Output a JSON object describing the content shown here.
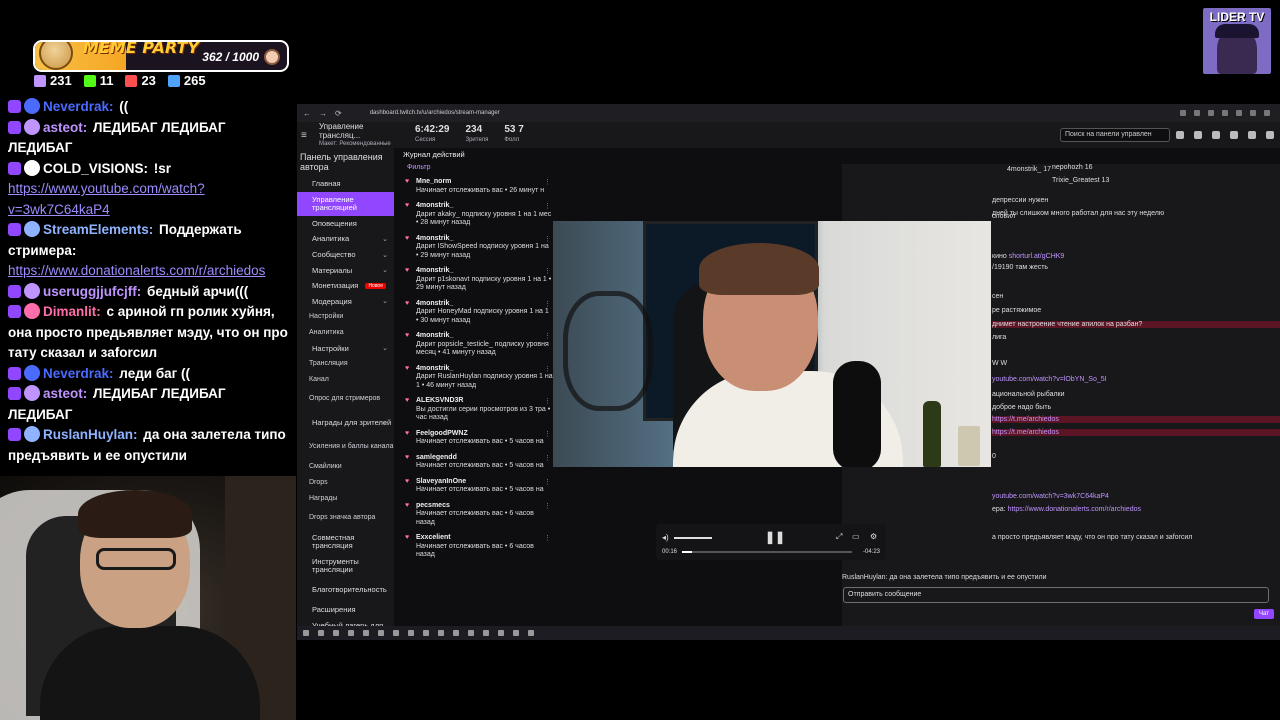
{
  "meme_party": {
    "title": "MEME PARTY",
    "count": "362 / 1000",
    "progress": 0.362
  },
  "stats": [
    {
      "icon": "twitch-icon",
      "value": "231",
      "color": "#bf94ff"
    },
    {
      "icon": "kick-icon",
      "value": "11",
      "color": "#53fc18"
    },
    {
      "icon": "live-icon",
      "value": "23",
      "color": "#ff4f4f"
    },
    {
      "icon": "viewers-icon",
      "value": "265",
      "color": "#4fa3ff"
    }
  ],
  "chat": [
    {
      "nick": "Neverdrak:",
      "nick_color": "#4b6bff",
      "text": " ((",
      "link": ""
    },
    {
      "nick": "asteot:",
      "nick_color": "#bf94ff",
      "text": " ЛЕДИБАГ ЛЕДИБАГ ЛЕДИБАГ",
      "link": ""
    },
    {
      "nick": "COLD_VISIONS:",
      "nick_color": "#ffffff",
      "text": " !sr",
      "link": "https://www.youtube.com/watch?v=3wk7C64kaP4"
    },
    {
      "nick": "StreamElements:",
      "nick_color": "#8fb3ff",
      "text": " Поддержать стримера:",
      "link": "https://www.donationalerts.com/r/archiedos"
    },
    {
      "nick": "useruggjjufcjff:",
      "nick_color": "#bf94ff",
      "text": " бедный арчи(((",
      "link": ""
    },
    {
      "nick": "Dimanlit:",
      "nick_color": "#ff6dab",
      "text": " с ариной гп ролик хуйня, она просто предьявляет мэду, что он про тату сказал и заforсил",
      "link": ""
    },
    {
      "nick": "Neverdrak:",
      "nick_color": "#4b6bff",
      "text": " леди баг ((",
      "link": ""
    },
    {
      "nick": "asteot:",
      "nick_color": "#bf94ff",
      "text": " ЛЕДИБАГ ЛЕДИБАГ ЛЕДИБАГ",
      "link": ""
    },
    {
      "nick": "RuslanHuylan:",
      "nick_color": "#8fb3ff",
      "text": " да она залетела типо предъявить и ее опустили",
      "link": ""
    }
  ],
  "browser": {
    "url": "dashboard.twitch.tv/u/archiedos/stream-manager"
  },
  "header": {
    "title": "Управление трансляц...",
    "subtitle": "Макет: Рекомендованные",
    "session": "6:42:29",
    "session_label": "Сессия",
    "viewers": "234",
    "viewers_label": "Зрителя",
    "followers": "53 7",
    "followers_label": "Фолл",
    "search_placeholder": "Поиск на панели управлен"
  },
  "sidebar": {
    "title": "Панель управления автора",
    "items": [
      {
        "label": "Главная",
        "type": "main",
        "chev": false
      },
      {
        "label": "Управление трансляцией",
        "type": "active",
        "chev": false
      },
      {
        "label": "Оповещения",
        "type": "main",
        "chev": false
      },
      {
        "label": "Аналитика",
        "type": "main",
        "chev": true
      },
      {
        "label": "Сообщество",
        "type": "main",
        "chev": true
      },
      {
        "label": "Материалы",
        "type": "main",
        "chev": true
      },
      {
        "label": "Монетизация",
        "type": "main",
        "chev": true,
        "badge": "Новое"
      },
      {
        "label": "Модерация",
        "type": "main",
        "chev": true
      },
      {
        "label": "Настройки",
        "type": "sub",
        "chev": false
      },
      {
        "label": "Аналитика",
        "type": "sub",
        "chev": false
      },
      {
        "label": "Настройки",
        "type": "main",
        "chev": true
      },
      {
        "label": "Трансляция",
        "type": "sub",
        "chev": false
      },
      {
        "label": "Канал",
        "type": "sub",
        "chev": false
      },
      {
        "label": "Опрос для стримеров",
        "type": "sub",
        "chev": false
      },
      {
        "label": "Награды для зрителей",
        "type": "main",
        "chev": true
      },
      {
        "label": "Усиления и баллы канала",
        "type": "sub",
        "chev": false
      },
      {
        "label": "Смайлики",
        "type": "sub",
        "chev": false
      },
      {
        "label": "Drops",
        "type": "sub",
        "chev": false
      },
      {
        "label": "Награды",
        "type": "sub",
        "chev": false
      },
      {
        "label": "Drops значка автора",
        "type": "sub",
        "chev": false
      },
      {
        "label": "Совместная трансляция",
        "type": "main",
        "chev": false
      },
      {
        "label": "Инструменты трансляции",
        "type": "main",
        "chev": false
      },
      {
        "label": "Благотворительность",
        "type": "main",
        "chev": false
      },
      {
        "label": "Расширения",
        "type": "main",
        "chev": false
      },
      {
        "label": "Учебный лагерь для стримеров",
        "type": "main",
        "chev": false
      }
    ]
  },
  "feed": {
    "title": "Журнал действий",
    "filter": "Фильтр",
    "items": [
      {
        "name": "Mne_norm",
        "text": "Начинает отслеживать вас • 26 минут н"
      },
      {
        "name": "4monstrik_",
        "text": "Дарит akaky_ подписку уровня 1 на 1 мес • 28 минут назад"
      },
      {
        "name": "4monstrik_",
        "text": "Дарит IShowSpeed подписку уровня 1 на • 29 минут назад"
      },
      {
        "name": "4monstrik_",
        "text": "Дарит p1skonavt подписку уровня 1 на 1 • 29 минут назад"
      },
      {
        "name": "4monstrik_",
        "text": "Дарит HoneyMad подписку уровня 1 на 1 • 30 минут назад"
      },
      {
        "name": "4monstrik_",
        "text": "Дарит popsicle_testicle_ подписку уровня месяц • 41 минуту назад"
      },
      {
        "name": "4monstrik_",
        "text": "Дарит RuslanHuylan подписку уровня 1 на 1 • 46 минут назад"
      },
      {
        "name": "ALEKSVND3R",
        "text": "Вы достигли серии просмотров из 3 тра • час назад"
      },
      {
        "name": "FeelgoodPWNZ",
        "text": "Начинает отслеживать вас • 5 часов на"
      },
      {
        "name": "samlegendd",
        "text": "Начинает отслеживать вас • 5 часов на"
      },
      {
        "name": "SlaveyanInOne",
        "text": "Начинает отслеживать вас • 5 часов на"
      },
      {
        "name": "pecsmecs",
        "text": "Начинает отслеживать вас • 6 часов назад"
      },
      {
        "name": "Exxcelient",
        "text": "Начинает отслеживать вас • 6 часов назад"
      }
    ]
  },
  "right_chat": {
    "top_users": [
      {
        "name": "4monstrik_",
        "count": "17"
      },
      {
        "name": "nepohozh",
        "count": "16"
      },
      {
        "name": "Trixie_Greatest",
        "count": "13"
      }
    ],
    "lines": [
      {
        "text": "депрессии нужен",
        "hl": false,
        "link": ""
      },
      {
        "text": "дней ты слишком много работал для нас эту неделю",
        "hl": false,
        "link": ""
      },
      {
        "text": "словил",
        "hl": false,
        "link": ""
      },
      {
        "text": "кино",
        "hl": false,
        "link": "shorturl.at/gCHK9"
      },
      {
        "text": "/19190 там жесть",
        "hl": false,
        "link": ""
      },
      {
        "text": "сен",
        "hl": false,
        "link": ""
      },
      {
        "text": "ре растяжимое",
        "hl": false,
        "link": ""
      },
      {
        "text": "днимет настроение чтение апилок на разбан?",
        "hl": true,
        "link": ""
      },
      {
        "text": "лига",
        "hl": false,
        "link": ""
      },
      {
        "text": "W W",
        "hl": false,
        "link": ""
      },
      {
        "text": "",
        "hl": false,
        "link": "youtube.com/watch?v=lObYN_So_5I"
      },
      {
        "text": "ациональной рыбалки",
        "hl": false,
        "link": ""
      },
      {
        "text": "доброе надо быть",
        "hl": false,
        "link": ""
      },
      {
        "text": "",
        "hl": true,
        "link": "https://t.me/archiedos"
      },
      {
        "text": "",
        "hl": true,
        "link": "https://t.me/archiedos"
      },
      {
        "text": "0",
        "hl": false,
        "link": ""
      },
      {
        "text": "",
        "hl": false,
        "link": "youtube.com/watch?v=3wk7C64kaP4"
      },
      {
        "text": "ера:",
        "hl": false,
        "link": "https://www.donationalerts.com/r/archiedos"
      },
      {
        "text": "а просто предъявляет мэду, что он про тату сказал и заforсил",
        "hl": false,
        "link": ""
      },
      {
        "text": "RuslanHuylan: да она залетела типо предъявить и ее опустили",
        "hl": false,
        "link": ""
      }
    ],
    "input_placeholder": "Отправить сообщение",
    "chat_button": "Чат",
    "points": "0"
  },
  "player": {
    "time_current": "00:16",
    "time_remaining": "-04:23",
    "progress": 0.06
  },
  "streamer": {
    "name": "LIDER TV"
  }
}
